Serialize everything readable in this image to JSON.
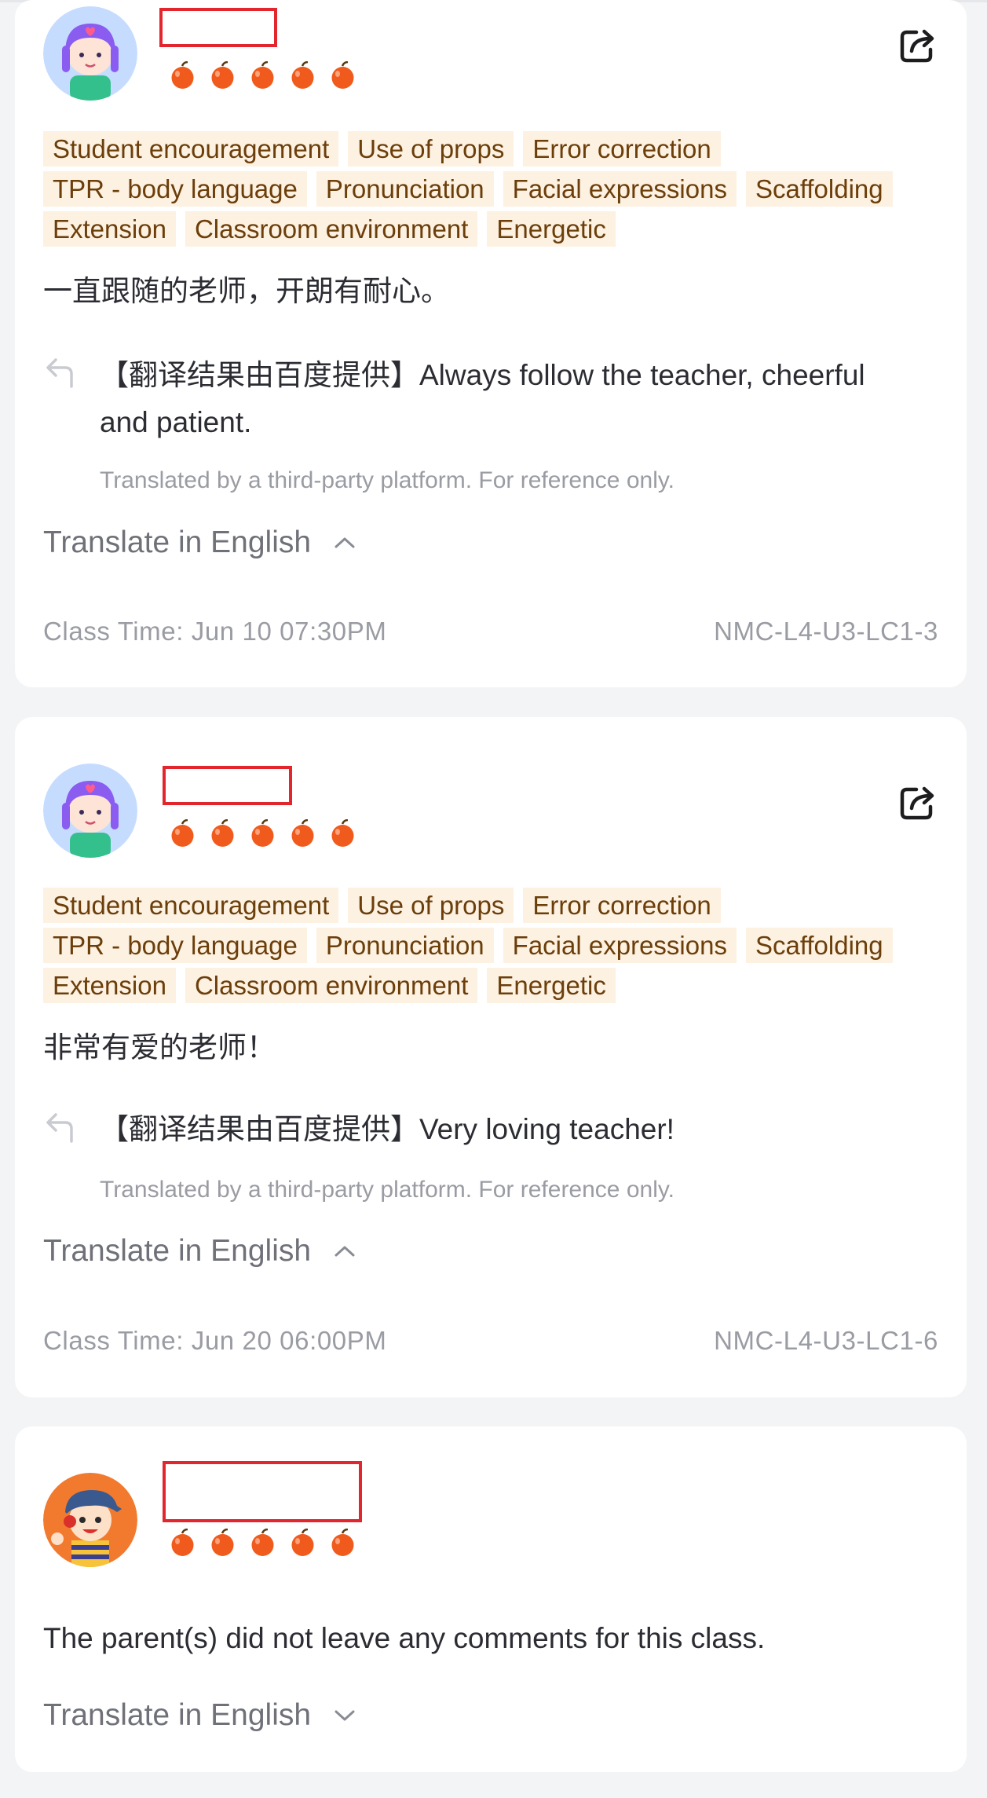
{
  "reviews": [
    {
      "avatar": "girl-avatar",
      "rating": 5,
      "tags": [
        "Student encouragement",
        "Use of props",
        "Error correction",
        "TPR - body language",
        "Pronunciation",
        "Facial expressions",
        "Scaffolding",
        "Extension",
        "Classroom environment",
        "Energetic"
      ],
      "comment": "一直跟随的老师，开朗有耐心。",
      "translation": "【翻译结果由百度提供】Always follow the teacher, cheerful and patient.",
      "translation_note": "Translated by a third-party platform. For reference only.",
      "translate_label": "Translate in English",
      "translate_expanded": true,
      "class_time": "Class Time: Jun 10 07:30PM",
      "class_code": "NMC-L4-U3-LC1-3"
    },
    {
      "avatar": "girl-avatar",
      "rating": 5,
      "tags": [
        "Student encouragement",
        "Use of props",
        "Error correction",
        "TPR - body language",
        "Pronunciation",
        "Facial expressions",
        "Scaffolding",
        "Extension",
        "Classroom environment",
        "Energetic"
      ],
      "comment": "非常有爱的老师！",
      "translation": "【翻译结果由百度提供】Very loving teacher!",
      "translation_note": "Translated by a third-party platform. For reference only.",
      "translate_label": "Translate in English",
      "translate_expanded": true,
      "class_time": "Class Time: Jun 20 06:00PM",
      "class_code": "NMC-L4-U3-LC1-6"
    },
    {
      "avatar": "boy-avatar",
      "rating": 5,
      "comment": "The parent(s) did not leave any comments for this class.",
      "translate_label": "Translate in English",
      "translate_expanded": false
    }
  ],
  "colors": {
    "accent_tag_bg": "#fdf1e2",
    "accent_tag_text": "#6b3e0a",
    "rating": "#f05a1c",
    "redact_box": "#e3262e"
  },
  "icons": {
    "share": "share-icon",
    "translate": "translate-arrow-icon",
    "rating": "apple-icon",
    "expand": "chevron-down-icon",
    "collapse": "chevron-up-icon"
  }
}
